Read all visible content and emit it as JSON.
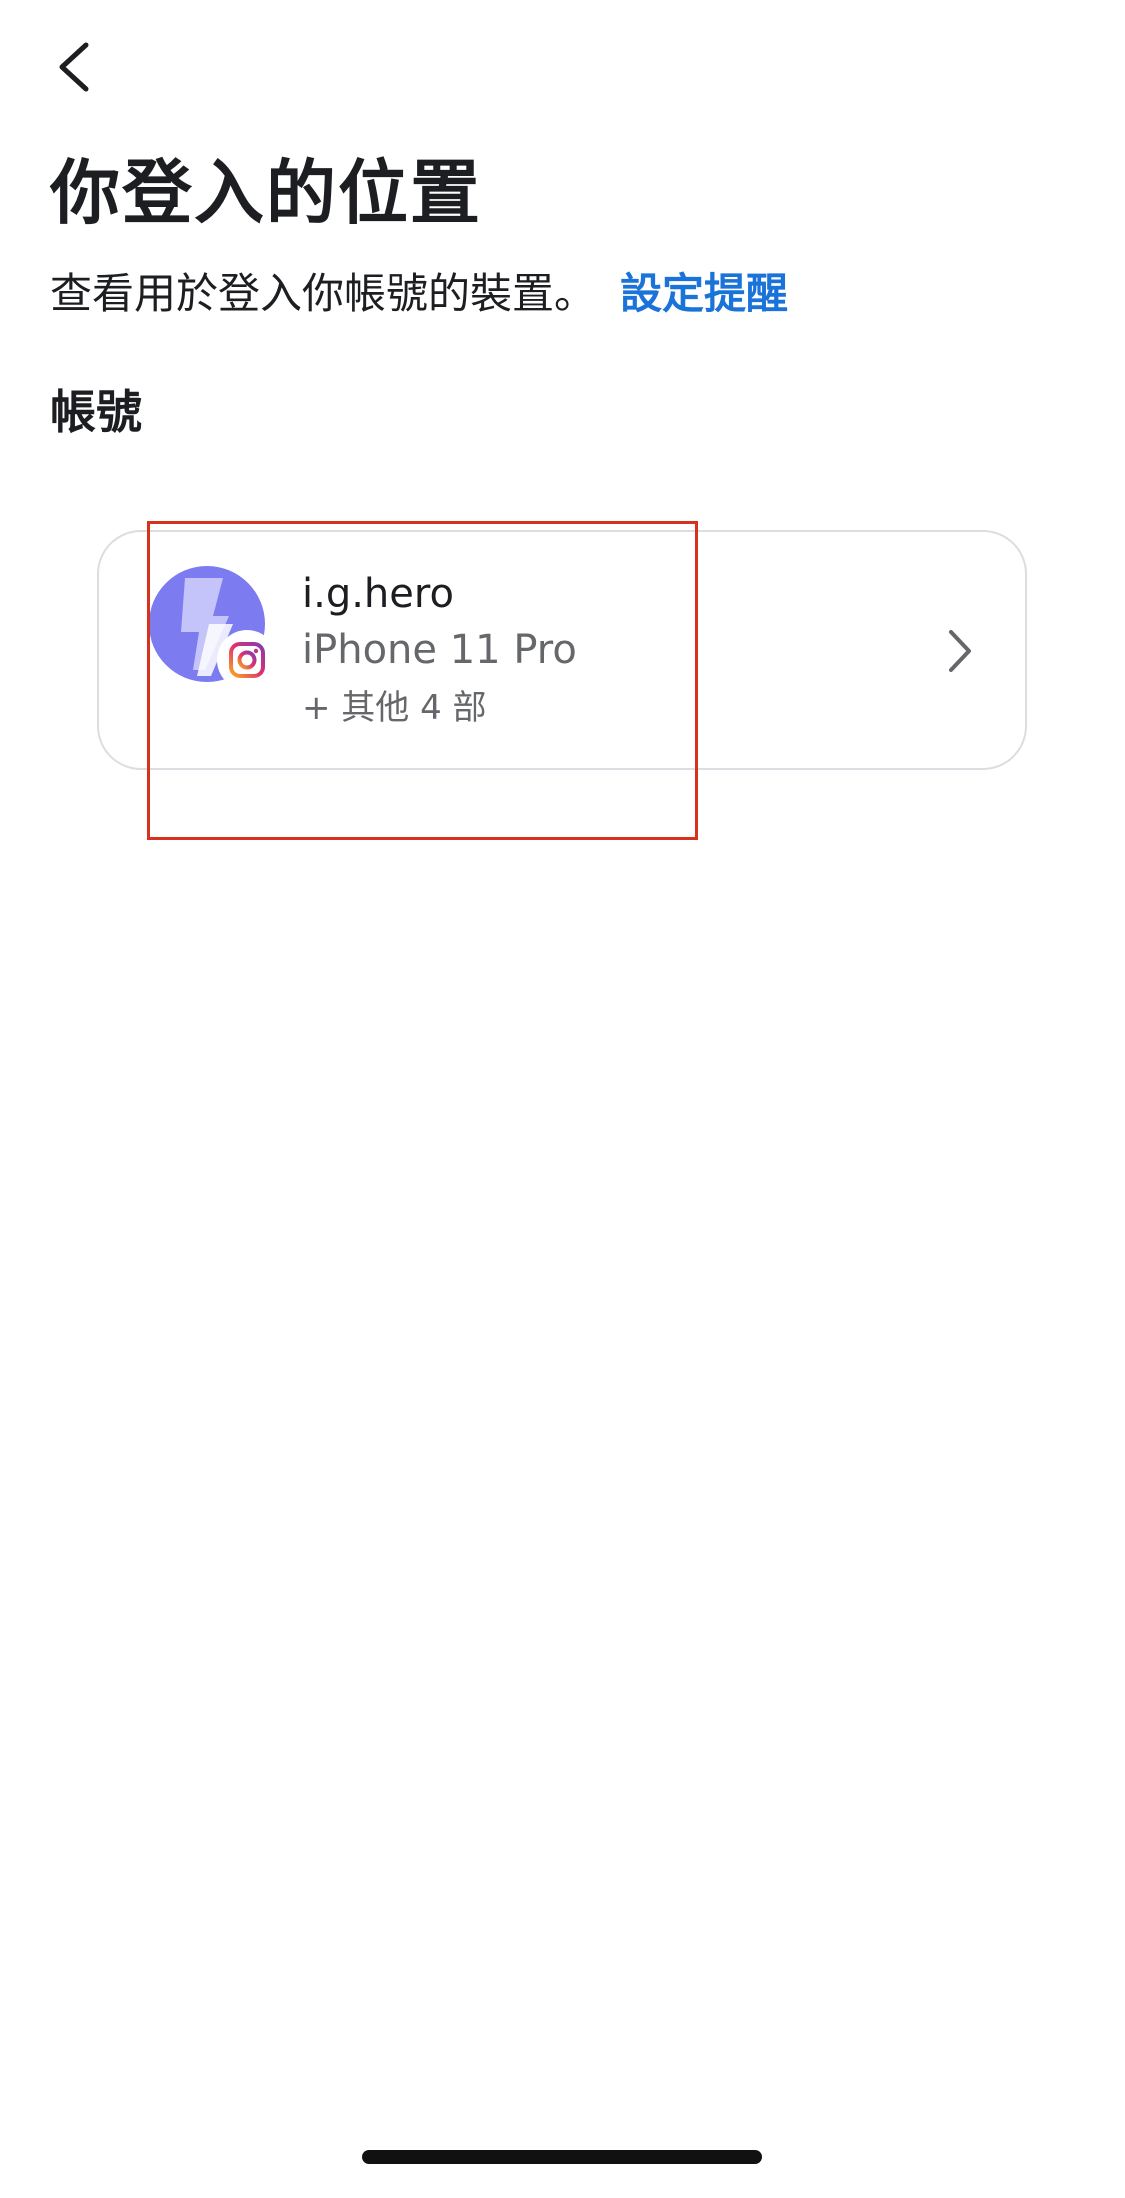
{
  "header": {
    "back_icon": "chevron-left-icon"
  },
  "page": {
    "title": "你登入的位置",
    "subtitle": "查看用於登入你帳號的裝置。",
    "set_reminder_link": "設定提醒",
    "section_heading": "帳號"
  },
  "account": {
    "username": "i.g.hero",
    "device": "iPhone 11 Pro",
    "others": "+ 其他 4 部",
    "app_badge_icon": "instagram-icon",
    "chevron_icon": "chevron-right-icon"
  },
  "colors": {
    "link": "#1a73d9",
    "text_primary": "#1c1e21",
    "text_secondary": "#65676b",
    "avatar_bg": "#7c7cf0",
    "highlight": "#d6321e"
  }
}
